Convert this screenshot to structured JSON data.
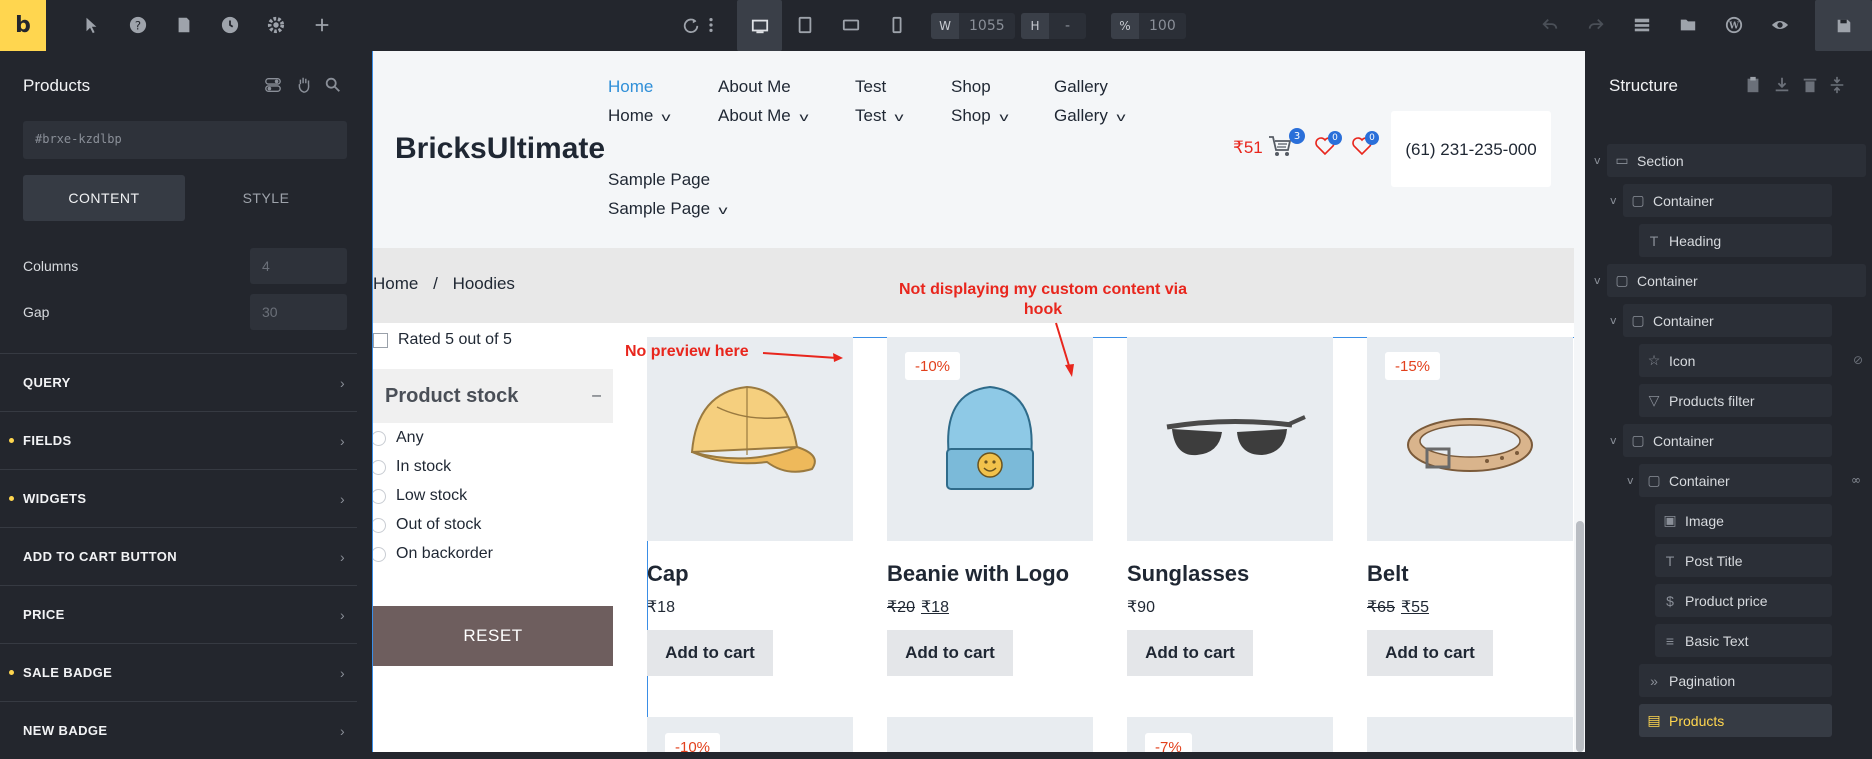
{
  "toolbar": {
    "logo": "b",
    "width_label": "W",
    "width_value": "1055",
    "height_label": "H",
    "height_value": "-",
    "percent_label": "%",
    "percent_value": "100"
  },
  "left_panel": {
    "title": "Products",
    "element_id": "#brxe-kzdlbp",
    "tabs": [
      "CONTENT",
      "STYLE"
    ],
    "columns_label": "Columns",
    "columns_placeholder": "4",
    "gap_label": "Gap",
    "gap_placeholder": "30",
    "sections": [
      {
        "label": "QUERY",
        "marked": false
      },
      {
        "label": "FIELDS",
        "marked": true
      },
      {
        "label": "WIDGETS",
        "marked": true
      },
      {
        "label": "ADD TO CART BUTTON",
        "marked": false
      },
      {
        "label": "PRICE",
        "marked": false
      },
      {
        "label": "SALE BADGE",
        "marked": true
      },
      {
        "label": "NEW BADGE",
        "marked": false
      }
    ]
  },
  "site": {
    "brand": "BricksUltimate",
    "nav": [
      {
        "top": "Home",
        "bottom": "Home"
      },
      {
        "top": "About Me",
        "bottom": "About Me"
      },
      {
        "top": "Test",
        "bottom": "Test"
      },
      {
        "top": "Shop",
        "bottom": "Shop"
      },
      {
        "top": "Gallery",
        "bottom": "Gallery"
      },
      {
        "top": "Sample Page",
        "bottom": "Sample Page"
      }
    ],
    "cart_total": "₹51",
    "cart_count": "3",
    "wishlist_count": "0",
    "compare_count": "0",
    "phone": "(61) 231-235-000",
    "breadcrumb": {
      "home": "Home",
      "sep": "/",
      "current": "Hoodies"
    }
  },
  "filter": {
    "rated_label": "Rated 5 out of 5",
    "stock_heading": "Product stock",
    "collapse_symbol": "–",
    "options": [
      "Any",
      "In stock",
      "Low stock",
      "Out of stock",
      "On backorder"
    ],
    "reset_label": "RESET"
  },
  "products": [
    {
      "name": "Cap",
      "badge": "",
      "price_old": "",
      "price": "₹18"
    },
    {
      "name": "Beanie with Logo",
      "badge": "-10%",
      "price_old": "₹20",
      "price": "₹18"
    },
    {
      "name": "Sunglasses",
      "badge": "",
      "price_old": "",
      "price": "₹90"
    },
    {
      "name": "Belt",
      "badge": "-15%",
      "price_old": "₹65",
      "price": "₹55"
    }
  ],
  "add_to_cart_label": "Add to cart",
  "second_row_badges": [
    "-10%",
    "-7%"
  ],
  "annotations": {
    "no_preview": "No preview here",
    "custom_content": "Not displaying my custom content via hook"
  },
  "structure": {
    "title": "Structure",
    "items": [
      "Section",
      "Container",
      "Heading",
      "Container",
      "Container",
      "Icon",
      "Products filter",
      "Container",
      "Container",
      "Image",
      "Post Title",
      "Product price",
      "Basic Text",
      "Pagination",
      "Products"
    ]
  },
  "colors": {
    "accent": "#ffd64f",
    "link_blue": "#2f8fd8",
    "sale_red": "#e2401c",
    "annotation_red": "#e8261d",
    "reset_bg": "#6e5e5e"
  }
}
